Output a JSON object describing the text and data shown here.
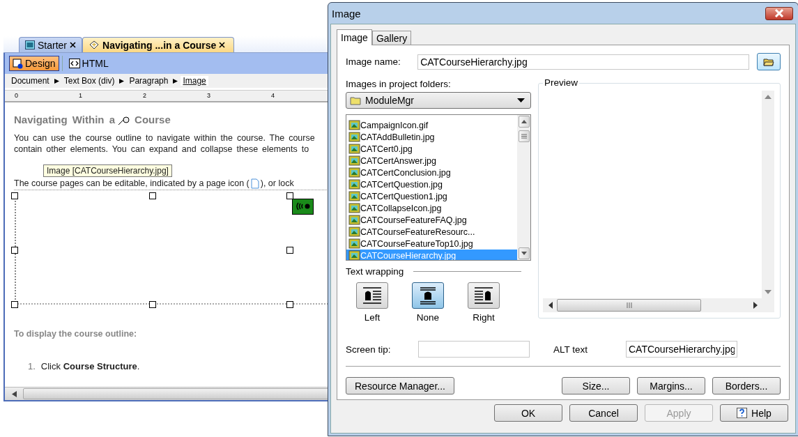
{
  "editor": {
    "tabs": [
      {
        "label": "Starter",
        "selected": false
      },
      {
        "label": "Navigating ...in a Course",
        "selected": true
      }
    ],
    "views": [
      {
        "label": "Design",
        "kind": "design",
        "selected": true
      },
      {
        "label": "HTML",
        "kind": "html",
        "selected": false
      }
    ],
    "breadcrumb": [
      {
        "label": "Document",
        "selected": false
      },
      {
        "label": "Text Box (div)",
        "selected": false
      },
      {
        "label": "Paragraph",
        "selected": false
      },
      {
        "label": "Image",
        "selected": true
      }
    ],
    "ruler": [
      "0",
      "1",
      "2",
      "3",
      "4"
    ],
    "heading_start": "Navigating Within a",
    "heading_end": "Course",
    "paragraph_lines": [
      "You can use the course outline to navigate within the course. The course",
      "contain other elements. You can expand and collapse these elements to"
    ],
    "tooltip": "Image [CATCourseHierarchy.jpg]",
    "line_before_icon": "The course pages can be editable, indicated by a page icon (",
    "line_after_icon": "), or lock",
    "subheading": "To display the course outline:",
    "steps": [
      {
        "number": "1.",
        "text": "Click **Course Structure**."
      }
    ]
  },
  "dialog": {
    "title": "Image",
    "tabs": [
      {
        "label": "Image",
        "selected": true
      },
      {
        "label": "Gallery",
        "selected": false
      }
    ],
    "image_name": {
      "label": "Image name:",
      "value": "CATCourseHierarchy.jpg"
    },
    "folders_label": "Images in project folders:",
    "folder": "ModuleMgr",
    "files": [
      {
        "name": "CampaignIcon.gif",
        "selected": false
      },
      {
        "name": "CATAddBulletin.jpg",
        "selected": false
      },
      {
        "name": "CATCert0.jpg",
        "selected": false
      },
      {
        "name": "CATCertAnswer.jpg",
        "selected": false
      },
      {
        "name": "CATCertConclusion.jpg",
        "selected": false
      },
      {
        "name": "CATCertQuestion.jpg",
        "selected": false
      },
      {
        "name": "CATCertQuestion1.jpg",
        "selected": false
      },
      {
        "name": "CATCollapseIcon.jpg",
        "selected": false
      },
      {
        "name": "CATCourseFeatureFAQ.jpg",
        "selected": false
      },
      {
        "name": "CATCourseFeatureResourc...",
        "selected": false
      },
      {
        "name": "CATCourseFeatureTop10.jpg",
        "selected": false
      },
      {
        "name": "CATCourseHierarchy.jpg",
        "selected": true
      }
    ],
    "wrapping": {
      "label": "Text wrapping",
      "options": [
        {
          "label": "Left",
          "kind": "left",
          "selected": false
        },
        {
          "label": "None",
          "kind": "none",
          "selected": true
        },
        {
          "label": "Right",
          "kind": "right",
          "selected": false
        }
      ]
    },
    "preview": {
      "label": "Preview"
    },
    "screen_tip": {
      "label": "Screen tip:"
    },
    "alt_text": {
      "label": "ALT text",
      "value": "CATCourseHierarchy.jpg"
    },
    "tool_buttons": [
      "Resource Manager...",
      "Size...",
      "Margins...",
      "Borders..."
    ],
    "buttons": [
      {
        "label": "OK",
        "kind": "plain",
        "disabled": false
      },
      {
        "label": "Cancel",
        "kind": "plain",
        "disabled": false
      },
      {
        "label": "Apply",
        "kind": "plain",
        "disabled": true
      },
      {
        "label": "Help",
        "kind": "help",
        "disabled": false
      }
    ]
  }
}
